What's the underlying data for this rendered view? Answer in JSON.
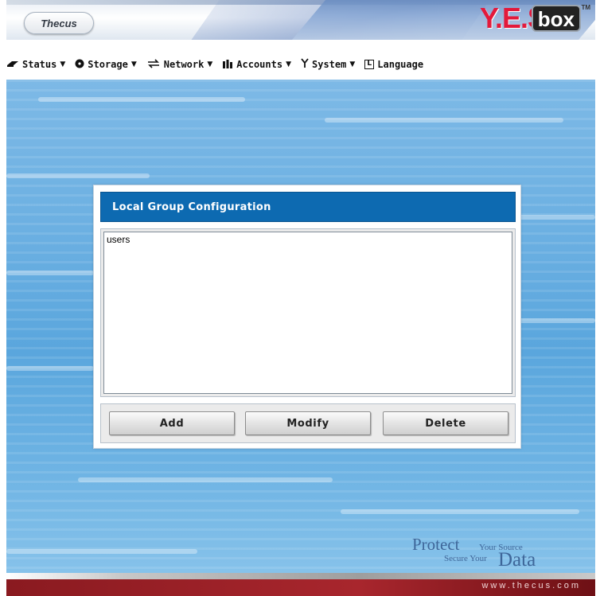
{
  "header": {
    "logo_left": "Thecus",
    "logo_right": "Y.E.S",
    "logo_box": "box",
    "tm": "TM"
  },
  "nav": {
    "items": [
      {
        "label": "Status",
        "icon": "hard-drive-icon",
        "has_dropdown": true
      },
      {
        "label": "Storage",
        "icon": "disk-icon",
        "has_dropdown": true
      },
      {
        "label": "Network",
        "icon": "network-arrows-icon",
        "has_dropdown": true
      },
      {
        "label": "Accounts",
        "icon": "accounts-icon",
        "has_dropdown": true
      },
      {
        "label": "System",
        "icon": "tools-icon",
        "has_dropdown": true
      },
      {
        "label": "Language",
        "icon": "language-icon",
        "has_dropdown": false
      }
    ]
  },
  "panel": {
    "title": "Local Group Configuration",
    "groups": [
      "users"
    ],
    "buttons": {
      "add": "Add",
      "modify": "Modify",
      "delete": "Delete"
    }
  },
  "tagline": {
    "protect": "Protect",
    "your_source": "Your Source",
    "secure_your": "Secure Your",
    "data": "Data"
  },
  "footer": {
    "url": "www.thecus.com"
  },
  "colors": {
    "panel_title_bg": "#0d6ab1",
    "background_blue": "#6cb0e2",
    "footer_red": "#a8262d",
    "logo_red": "#e3193b"
  }
}
